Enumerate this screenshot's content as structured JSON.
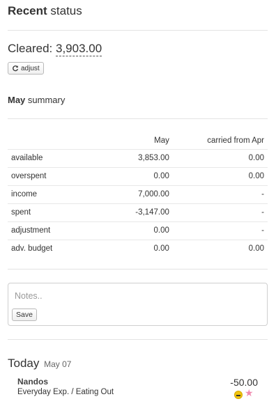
{
  "header": {
    "title_bold": "Recent",
    "title_rest": " status"
  },
  "cleared": {
    "label": "Cleared: ",
    "amount": "3,903.00"
  },
  "adjust": {
    "label": "adjust",
    "icon": "refresh-icon"
  },
  "summary": {
    "month_bold": "May",
    "title_rest": " summary",
    "columns": [
      "May",
      "carried from Apr"
    ],
    "rows": [
      {
        "label": "available",
        "may": "3,853.00",
        "apr": "0.00"
      },
      {
        "label": "overspent",
        "may": "0.00",
        "apr": "0.00"
      },
      {
        "label": "income",
        "may": "7,000.00",
        "apr": "-"
      },
      {
        "label": "spent",
        "may": "-3,147.00",
        "apr": "-"
      },
      {
        "label": "adjustment",
        "may": "0.00",
        "apr": "-"
      },
      {
        "label": "adv. budget",
        "may": "0.00",
        "apr": "0.00"
      }
    ]
  },
  "notes": {
    "placeholder": "Notes..",
    "save_label": "Save"
  },
  "today": {
    "label": "Today",
    "date": "May 07",
    "transactions": [
      {
        "name": "Nandos",
        "category": "Everyday Exp. / Eating Out",
        "amount": "-50.00",
        "status_icon": "minus-circle-icon",
        "flag_icon": "star-icon",
        "flag_color": "#f08bb0",
        "status_color": "#f1c40f"
      }
    ]
  }
}
